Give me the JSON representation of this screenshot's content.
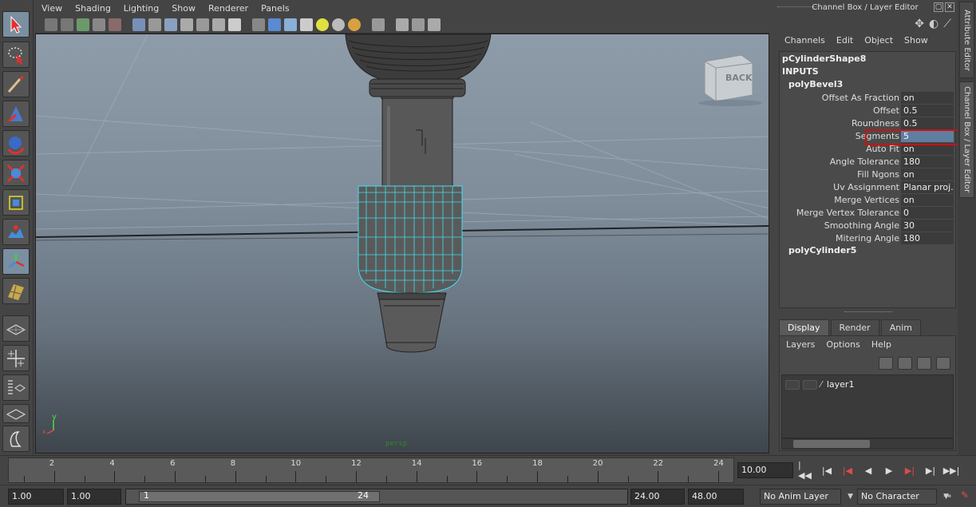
{
  "viewport": {
    "menu": [
      "View",
      "Shading",
      "Lighting",
      "Show",
      "Renderer",
      "Panels"
    ],
    "camera_label": "persp",
    "viewcube_label": "BACK",
    "axis": {
      "y": "y",
      "x": "x"
    }
  },
  "right_panel": {
    "title": "Channel Box / Layer Editor",
    "menu": [
      "Channels",
      "Edit",
      "Object",
      "Show"
    ],
    "object_name": "pCylinderShape8",
    "inputs_label": "INPUTS",
    "node1": "polyBevel3",
    "attributes": [
      {
        "label": "Offset As Fraction",
        "value": "on"
      },
      {
        "label": "Offset",
        "value": "0.5"
      },
      {
        "label": "Roundness",
        "value": "0.5"
      },
      {
        "label": "Segments",
        "value": "5"
      },
      {
        "label": "Auto Fit",
        "value": "on"
      },
      {
        "label": "Angle Tolerance",
        "value": "180"
      },
      {
        "label": "Fill Ngons",
        "value": "on"
      },
      {
        "label": "Uv Assignment",
        "value": "Planar proj..."
      },
      {
        "label": "Merge Vertices",
        "value": "on"
      },
      {
        "label": "Merge Vertex Tolerance",
        "value": "0"
      },
      {
        "label": "Smoothing Angle",
        "value": "30"
      },
      {
        "label": "Mitering Angle",
        "value": "180"
      }
    ],
    "node2": "polyCylinder5",
    "tabs": [
      "Display",
      "Render",
      "Anim"
    ],
    "layer_menu": [
      "Layers",
      "Options",
      "Help"
    ],
    "layer_name": "layer1",
    "side_tabs": [
      "Attribute Editor",
      "Channel Box / Layer Editor"
    ]
  },
  "timeline": {
    "ticks": [
      "2",
      "4",
      "6",
      "8",
      "10",
      "12",
      "14",
      "16",
      "18",
      "20",
      "22",
      "24"
    ],
    "current_frame": "10.00"
  },
  "range": {
    "start_field": "1.00",
    "start2_field": "1.00",
    "range_start": "1",
    "range_end": "24",
    "end_field": "24.00",
    "end2_field": "48.00",
    "anim_layer": "No Anim Layer",
    "character_set": "No Character Set"
  }
}
